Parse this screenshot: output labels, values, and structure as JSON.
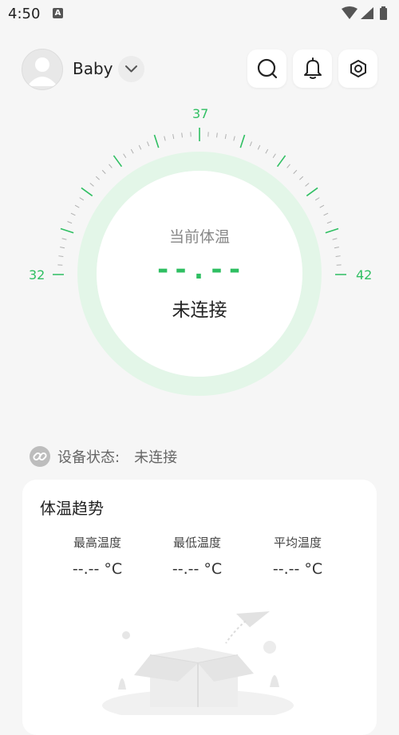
{
  "status_bar": {
    "time": "4:50",
    "app_icon": "A"
  },
  "header": {
    "profile_name": "Baby"
  },
  "gauge": {
    "tick_min": "32",
    "tick_mid": "37",
    "tick_max": "42",
    "label": "当前体温",
    "value": "--.--",
    "status": "未连接",
    "accent": "#2fbf62",
    "ring_color": "#e3f6e8"
  },
  "device": {
    "label": "设备状态:",
    "value": "未连接"
  },
  "trend": {
    "title": "体温趋势",
    "max_label": "最高温度",
    "max_value": "--.-- °C",
    "min_label": "最低温度",
    "min_value": "--.-- °C",
    "avg_label": "平均温度",
    "avg_value": "--.-- °C"
  }
}
